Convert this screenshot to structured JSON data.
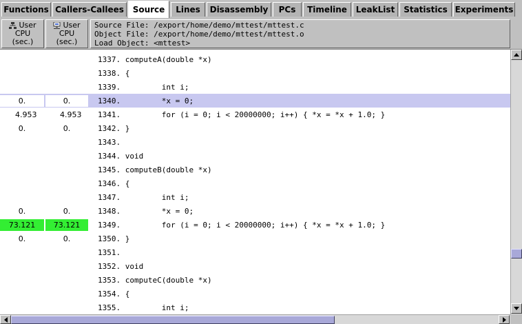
{
  "tabs": [
    {
      "label": "Functions",
      "active": false
    },
    {
      "label": "Callers-Callees",
      "active": false
    },
    {
      "label": "Source",
      "active": true
    },
    {
      "label": "Lines",
      "active": false
    },
    {
      "label": "Disassembly",
      "active": false
    },
    {
      "label": "PCs",
      "active": false
    },
    {
      "label": "Timeline",
      "active": false
    },
    {
      "label": "LeakList",
      "active": false
    },
    {
      "label": "Statistics",
      "active": false
    },
    {
      "label": "Experiments",
      "active": false
    }
  ],
  "columns": {
    "metric1": {
      "line1": "User",
      "line2": "CPU",
      "line3": "(sec.)",
      "icon": "hierarchy-icon"
    },
    "metric2": {
      "line1": "User",
      "line2": "CPU",
      "line3": "(sec.)",
      "icon": "network-icon"
    }
  },
  "source_info": {
    "source_file": "Source File: /export/home/demo/mttest/mttest.c",
    "object_file": "Object File: /export/home/demo/mttest/mttest.o",
    "load_object": "Load Object: <mttest>"
  },
  "rows": [
    {
      "m1": "",
      "m2": "",
      "code": "1337. computeA(double *x)"
    },
    {
      "m1": "",
      "m2": "",
      "code": "1338. {"
    },
    {
      "m1": "",
      "m2": "",
      "code": "1339.         int i;"
    },
    {
      "m1": "0.",
      "m2": "0.",
      "code": "1340.         *x = 0;",
      "selected": true
    },
    {
      "m1": "4.953",
      "m2": "4.953",
      "code": "1341.         for (i = 0; i < 20000000; i++) { *x = *x + 1.0; }"
    },
    {
      "m1": "0.",
      "m2": "0.",
      "code": "1342. }"
    },
    {
      "m1": "",
      "m2": "",
      "code": "1343."
    },
    {
      "m1": "",
      "m2": "",
      "code": "1344. void"
    },
    {
      "m1": "",
      "m2": "",
      "code": "1345. computeB(double *x)"
    },
    {
      "m1": "",
      "m2": "",
      "code": "1346. {"
    },
    {
      "m1": "",
      "m2": "",
      "code": "1347.         int i;"
    },
    {
      "m1": "0.",
      "m2": "0.",
      "code": "1348.         *x = 0;"
    },
    {
      "m1": "73.121",
      "m2": "73.121",
      "code": "1349.         for (i = 0; i < 20000000; i++) { *x = *x + 1.0; }",
      "hot": true
    },
    {
      "m1": "0.",
      "m2": "0.",
      "code": "1350. }"
    },
    {
      "m1": "",
      "m2": "",
      "code": "1351."
    },
    {
      "m1": "",
      "m2": "",
      "code": "1352. void"
    },
    {
      "m1": "",
      "m2": "",
      "code": "1353. computeC(double *x)"
    },
    {
      "m1": "",
      "m2": "",
      "code": "1354. {"
    },
    {
      "m1": "",
      "m2": "",
      "code": "1355.         int i;"
    }
  ],
  "colors": {
    "selected_row": "#c8c8f0",
    "hot_metric": "#33ee33",
    "scroll_thumb": "#a8a8d8"
  }
}
